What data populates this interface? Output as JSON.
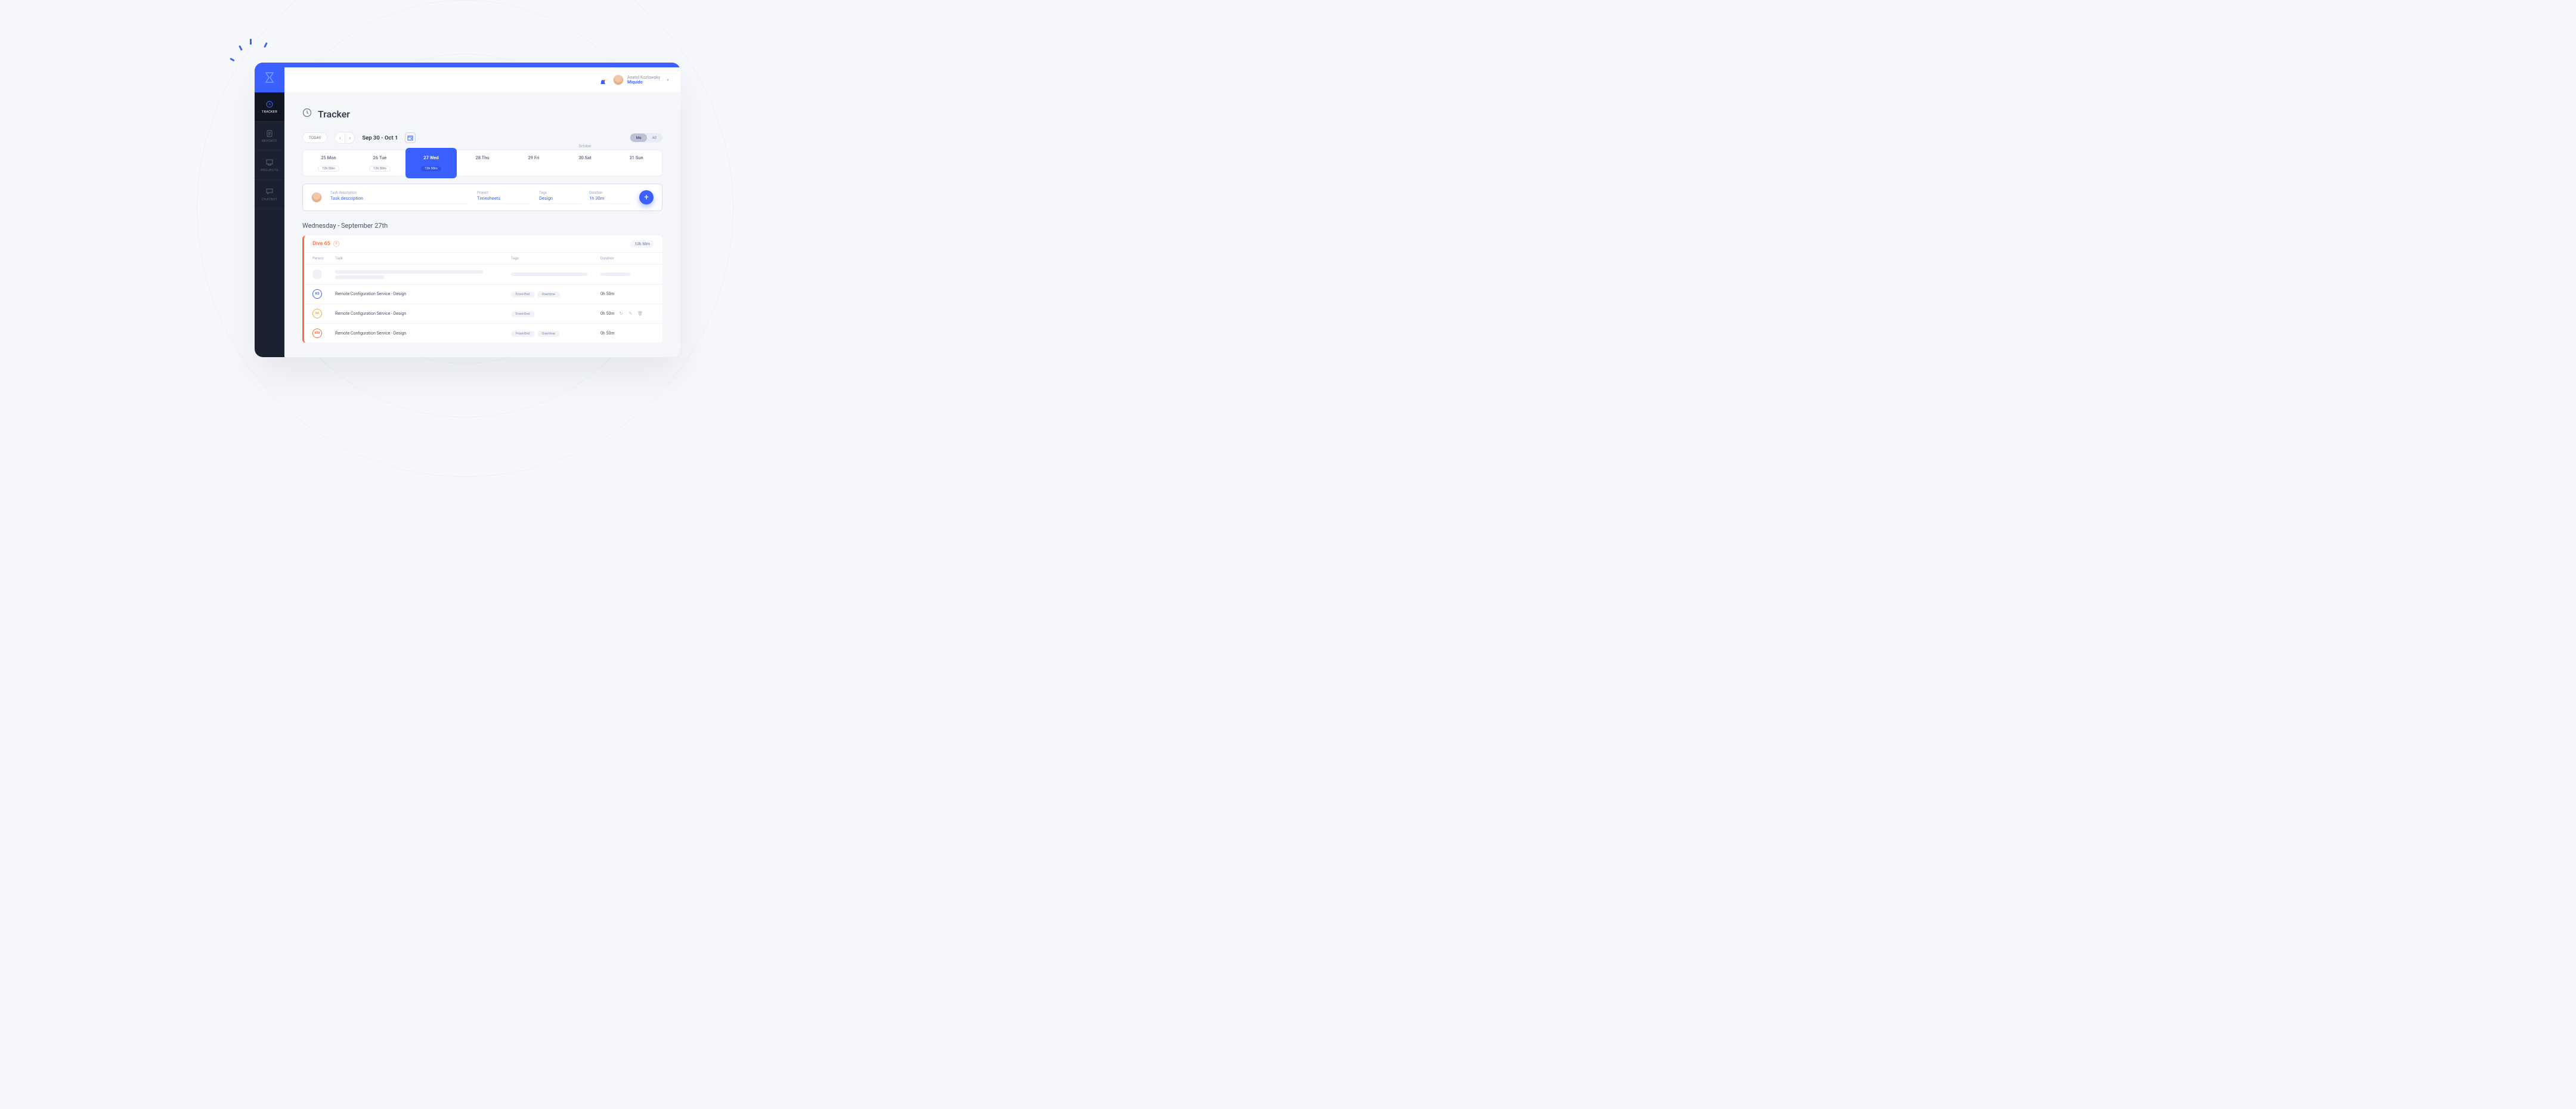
{
  "header": {
    "user_name": "Anatol Kozlowsky",
    "company": "Miquido"
  },
  "sidebar": {
    "items": [
      {
        "label": "TRACKER",
        "icon": "clock"
      },
      {
        "label": "REPORTS",
        "icon": "document"
      },
      {
        "label": "PROJECTS",
        "icon": "board"
      },
      {
        "label": "CHATBOT",
        "icon": "chat"
      }
    ]
  },
  "page": {
    "title": "Tracker",
    "today_btn": "TODAY",
    "date_range": "Sep 30 - Oct 1",
    "seg_me": "Me",
    "seg_all": "All",
    "month_label": "October"
  },
  "week": [
    {
      "label": "25 Mon",
      "badge": "12h 50m"
    },
    {
      "label": "26 Tue",
      "badge": "12h 50m"
    },
    {
      "label": "27 Wed",
      "badge": "12h 50m"
    },
    {
      "label": "28 Thu",
      "badge": ""
    },
    {
      "label": "29 Fri",
      "badge": ""
    },
    {
      "label": "30 Sat",
      "badge": ""
    },
    {
      "label": "31 Sun",
      "badge": ""
    }
  ],
  "entry": {
    "f1_label": "Task description",
    "f1_value": "Task description",
    "f2_label": "Project",
    "f2_value": "Timesheets",
    "f3_label": "Tags",
    "f3_value": "Design",
    "f4_label": "Duration",
    "f4_value": "1h 30m"
  },
  "day_heading": "Wednesday - September 27th",
  "panel": {
    "title": "Dive 65",
    "duration": "12h 50m",
    "col_person": "Person",
    "col_task": "Task",
    "col_tags": "Tags",
    "col_duration": "Duration"
  },
  "rows": [
    {
      "initials": "KS",
      "color": "#3a61ff",
      "task": "Remote Configuration Service - Design",
      "tags": [
        "Front-End",
        "Overtime"
      ],
      "dur": "0h 50m",
      "actions": false
    },
    {
      "initials": "RK",
      "color": "#f0b13c",
      "task": "Remote Configuration Service - Design",
      "tags": [
        "Front-End"
      ],
      "dur": "0h 50m",
      "actions": true
    },
    {
      "initials": "KM",
      "color": "#ff6a3d",
      "task": "Remote Configuration Service - Design",
      "tags": [
        "Front-End",
        "Overtime"
      ],
      "dur": "0h 50m",
      "actions": false
    }
  ]
}
